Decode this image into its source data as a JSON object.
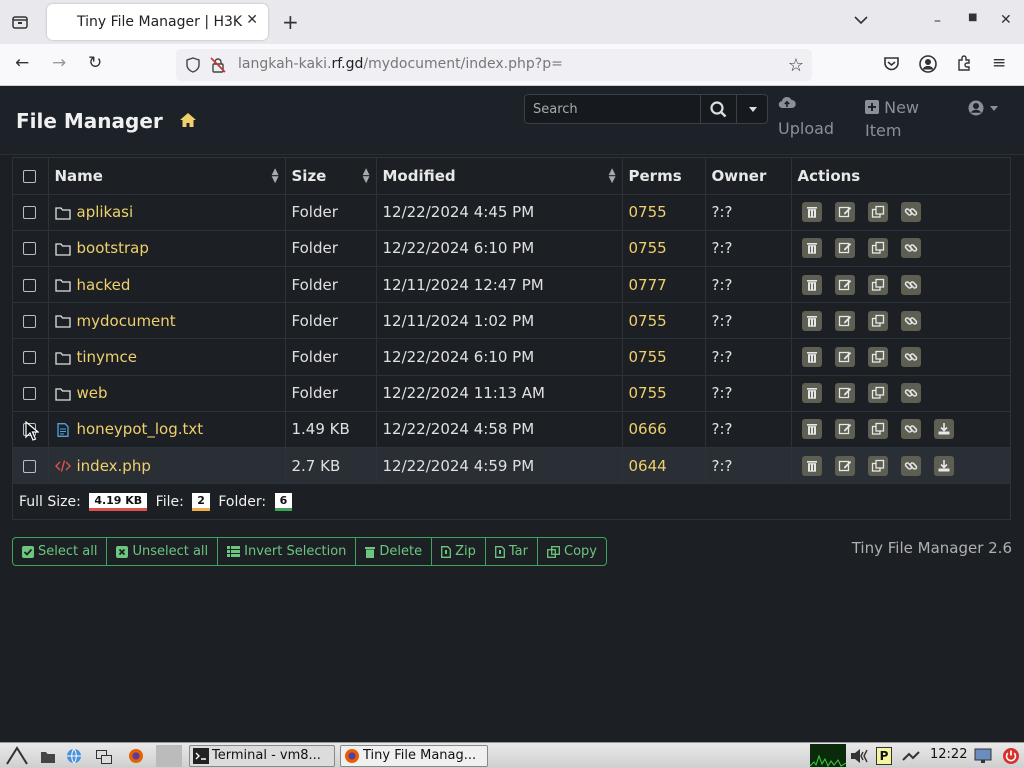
{
  "browser": {
    "tab_title": "Tiny File Manager | H3K",
    "url_host": "langkah-kaki.",
    "url_domain": "rf.gd",
    "url_path": "/mydocument/index.php?p="
  },
  "header": {
    "brand": "File Manager",
    "search_placeholder": "Search",
    "upload_label": "Upload",
    "new_item_line1": "New",
    "new_item_line2": "Item"
  },
  "table": {
    "columns": [
      "Name",
      "Size",
      "Modified",
      "Perms",
      "Owner",
      "Actions"
    ],
    "rows": [
      {
        "name": "aplikasi",
        "size": "Folder",
        "modified": "12/22/2024 4:45 PM",
        "perms": "0755",
        "owner": "?:?",
        "type": "folder"
      },
      {
        "name": "bootstrap",
        "size": "Folder",
        "modified": "12/22/2024 6:10 PM",
        "perms": "0755",
        "owner": "?:?",
        "type": "folder"
      },
      {
        "name": "hacked",
        "size": "Folder",
        "modified": "12/11/2024 12:47 PM",
        "perms": "0777",
        "owner": "?:?",
        "type": "folder"
      },
      {
        "name": "mydocument",
        "size": "Folder",
        "modified": "12/11/2024 1:02 PM",
        "perms": "0755",
        "owner": "?:?",
        "type": "folder"
      },
      {
        "name": "tinymce",
        "size": "Folder",
        "modified": "12/22/2024 6:10 PM",
        "perms": "0755",
        "owner": "?:?",
        "type": "folder"
      },
      {
        "name": "web",
        "size": "Folder",
        "modified": "12/22/2024 11:13 AM",
        "perms": "0755",
        "owner": "?:?",
        "type": "folder"
      },
      {
        "name": "honeypot_log.txt",
        "size": "1.49 KB",
        "modified": "12/22/2024 4:58 PM",
        "perms": "0666",
        "owner": "?:?",
        "type": "text"
      },
      {
        "name": "index.php",
        "size": "2.7 KB",
        "modified": "12/22/2024 4:59 PM",
        "perms": "0644",
        "owner": "?:?",
        "type": "code"
      }
    ],
    "footer": {
      "full_size_label": "Full Size:",
      "full_size_value": "4.19 KB",
      "file_label": "File:",
      "file_count": "2",
      "folder_label": "Folder:",
      "folder_count": "6"
    }
  },
  "toolbar": {
    "select_all": "Select all",
    "unselect_all": "Unselect all",
    "invert_selection": "Invert Selection",
    "delete": "Delete",
    "zip": "Zip",
    "tar": "Tar",
    "copy": "Copy"
  },
  "version": "Tiny File Manager 2.6",
  "taskbar": {
    "terminal": "Terminal - vm8...",
    "browser": "Tiny File Manag...",
    "clock": "12:22"
  },
  "colors": {
    "accent_green": "#3fa35a",
    "folder_yellow": "#f0d06c",
    "background": "#1c2025"
  }
}
